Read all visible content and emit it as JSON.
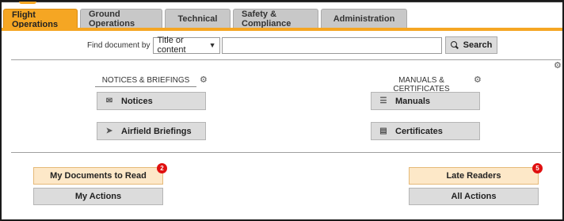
{
  "tabs": [
    {
      "label": "Flight Operations",
      "active": true
    },
    {
      "label": "Ground Operations",
      "active": false
    },
    {
      "label": "Technical",
      "active": false
    },
    {
      "label": "Safety & Compliance",
      "active": false
    },
    {
      "label": "Administration",
      "active": false
    }
  ],
  "search": {
    "label": "Find document by",
    "selected": "Title or content",
    "input_value": "",
    "button": "Search"
  },
  "sections": {
    "notices": {
      "title": "NOTICES & BRIEFINGS",
      "items": [
        {
          "label": "Notices",
          "icon": "envelope-icon"
        },
        {
          "label": "Airfield Briefings",
          "icon": "paper-plane-icon"
        }
      ]
    },
    "manuals": {
      "title": "MANUALS & CERTIFICATES",
      "items": [
        {
          "label": "Manuals",
          "icon": "layers-icon"
        },
        {
          "label": "Certificates",
          "icon": "certificate-icon"
        }
      ]
    }
  },
  "actions": {
    "my_documents": {
      "label": "My Documents to Read",
      "badge": "2"
    },
    "my_actions": {
      "label": "My Actions"
    },
    "late_readers": {
      "label": "Late Readers",
      "badge": "5"
    },
    "all_actions": {
      "label": "All Actions"
    }
  },
  "colors": {
    "accent": "#f5a623",
    "badge": "#e01010",
    "peach": "#fde8c8"
  }
}
